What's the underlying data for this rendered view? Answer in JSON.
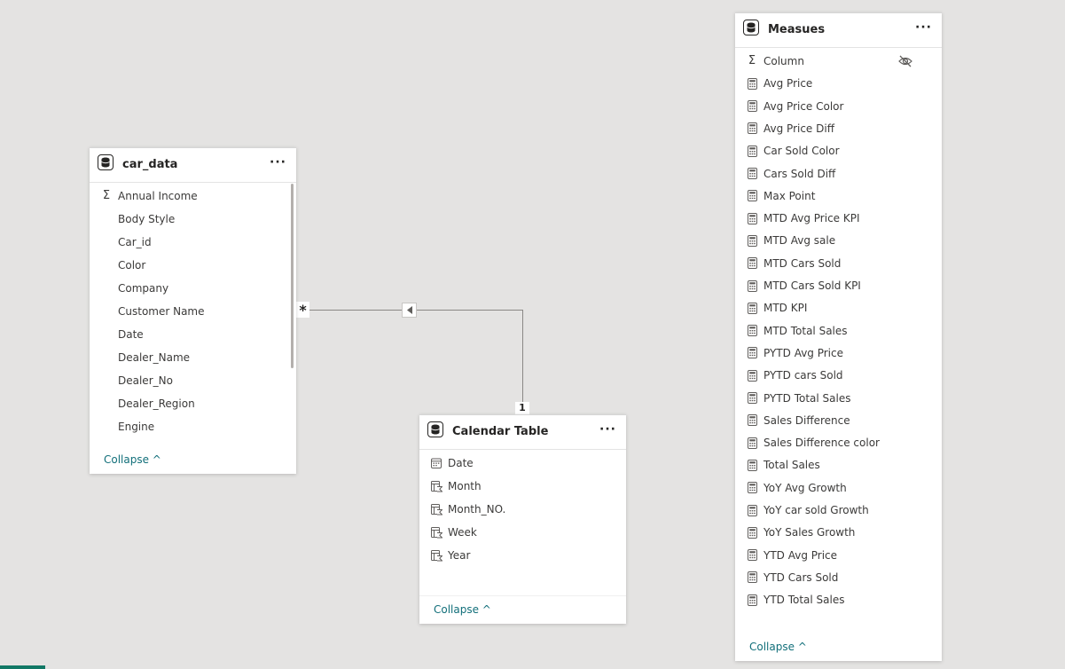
{
  "tables": {
    "car_data": {
      "title": "car_data",
      "more_label": "···",
      "fields": [
        {
          "name": "Annual Income",
          "icon": "sigma-icon"
        },
        {
          "name": "Body Style",
          "icon": "none"
        },
        {
          "name": "Car_id",
          "icon": "none"
        },
        {
          "name": "Color",
          "icon": "none"
        },
        {
          "name": "Company",
          "icon": "none"
        },
        {
          "name": "Customer Name",
          "icon": "none"
        },
        {
          "name": "Date",
          "icon": "none"
        },
        {
          "name": "Dealer_Name",
          "icon": "none"
        },
        {
          "name": "Dealer_No",
          "icon": "none"
        },
        {
          "name": "Dealer_Region",
          "icon": "none"
        },
        {
          "name": "Engine",
          "icon": "none"
        }
      ],
      "collapse_label": "Collapse ^"
    },
    "calendar": {
      "title": "Calendar Table",
      "more_label": "···",
      "fields": [
        {
          "name": "Date",
          "icon": "calendar-icon"
        },
        {
          "name": "Month",
          "icon": "calculated-column-icon"
        },
        {
          "name": "Month_NO.",
          "icon": "calculated-column-icon"
        },
        {
          "name": "Week",
          "icon": "calculated-column-icon"
        },
        {
          "name": "Year",
          "icon": "calculated-column-icon"
        }
      ],
      "collapse_label": "Collapse ^"
    },
    "measures": {
      "title": "Measues",
      "more_label": "···",
      "fields": [
        {
          "name": "Column",
          "icon": "sigma-icon"
        },
        {
          "name": "Avg Price",
          "icon": "measure-icon"
        },
        {
          "name": "Avg Price Color",
          "icon": "measure-icon"
        },
        {
          "name": "Avg Price Diff",
          "icon": "measure-icon"
        },
        {
          "name": "Car Sold Color",
          "icon": "measure-icon"
        },
        {
          "name": "Cars Sold Diff",
          "icon": "measure-icon"
        },
        {
          "name": "Max Point",
          "icon": "measure-icon"
        },
        {
          "name": "MTD Avg Price KPI",
          "icon": "measure-icon"
        },
        {
          "name": "MTD Avg sale",
          "icon": "measure-icon"
        },
        {
          "name": "MTD Cars Sold",
          "icon": "measure-icon"
        },
        {
          "name": "MTD Cars Sold KPI",
          "icon": "measure-icon"
        },
        {
          "name": "MTD KPI",
          "icon": "measure-icon"
        },
        {
          "name": "MTD Total Sales",
          "icon": "measure-icon"
        },
        {
          "name": "PYTD Avg Price",
          "icon": "measure-icon"
        },
        {
          "name": "PYTD cars Sold",
          "icon": "measure-icon"
        },
        {
          "name": "PYTD Total Sales",
          "icon": "measure-icon"
        },
        {
          "name": "Sales Difference",
          "icon": "measure-icon"
        },
        {
          "name": "Sales Difference color",
          "icon": "measure-icon"
        },
        {
          "name": "Total Sales",
          "icon": "measure-icon"
        },
        {
          "name": "YoY Avg Growth",
          "icon": "measure-icon"
        },
        {
          "name": "YoY car sold Growth",
          "icon": "measure-icon"
        },
        {
          "name": "YoY Sales Growth",
          "icon": "measure-icon"
        },
        {
          "name": "YTD Avg Price",
          "icon": "measure-icon"
        },
        {
          "name": "YTD Cars Sold",
          "icon": "measure-icon"
        },
        {
          "name": "YTD Total Sales",
          "icon": "measure-icon"
        }
      ],
      "collapse_label": "Collapse ^"
    }
  },
  "relationship": {
    "many_label": "*",
    "one_label": "1",
    "direction": "single-left"
  },
  "colors": {
    "canvas": "#e4e3e2",
    "link": "#126f7a",
    "bottom_tab": "#117865"
  }
}
